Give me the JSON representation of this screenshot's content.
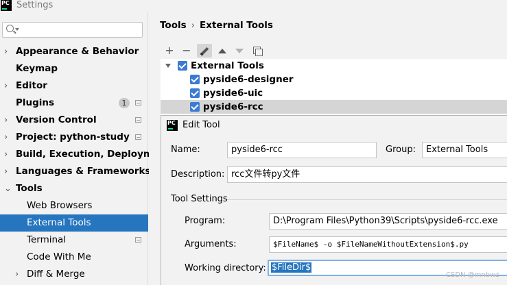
{
  "window": {
    "title": "Settings",
    "logo_text": "PC"
  },
  "search": {
    "placeholder": ""
  },
  "sidebar": {
    "items": [
      {
        "label": "Appearance & Behavior",
        "chevron": "›"
      },
      {
        "label": "Keymap",
        "chevron": ""
      },
      {
        "label": "Editor",
        "chevron": "›"
      },
      {
        "label": "Plugins",
        "chevron": "",
        "badge": "1"
      },
      {
        "label": "Version Control",
        "chevron": "›"
      },
      {
        "label": "Project: python-study",
        "chevron": "›"
      },
      {
        "label": "Build, Execution, Deployment",
        "chevron": "›"
      },
      {
        "label": "Languages & Frameworks",
        "chevron": "›"
      },
      {
        "label": "Tools",
        "chevron": "⌄"
      },
      {
        "label": "Web Browsers",
        "chevron": ""
      },
      {
        "label": "External Tools",
        "chevron": ""
      },
      {
        "label": "Terminal",
        "chevron": ""
      },
      {
        "label": "Code With Me",
        "chevron": ""
      },
      {
        "label": "Diff & Merge",
        "chevron": "›"
      }
    ]
  },
  "breadcrumb": {
    "parent": "Tools",
    "separator": "›",
    "current": "External Tools"
  },
  "toolbar": {
    "add": "+",
    "remove": "−"
  },
  "tree": {
    "group": "External Tools",
    "tools": [
      "pyside6-designer",
      "pyside6-uic",
      "pyside6-rcc"
    ]
  },
  "dialog": {
    "title": "Edit Tool",
    "logo_text": "PC",
    "name_label": "Name:",
    "name_value": "pyside6-rcc",
    "group_label": "Group:",
    "group_value": "External Tools",
    "description_label": "Description:",
    "description_value": "rcc文件转py文件",
    "section_title": "Tool Settings",
    "program_label": "Program:",
    "program_value": "D:\\Program Files\\Python39\\Scripts\\pyside6-rcc.exe",
    "arguments_label": "Arguments:",
    "arguments_value": "$FileName$ -o $FileNameWithoutExtension$.py",
    "workdir_label": "Working directory:",
    "workdir_value": "$FileDir$"
  },
  "watermark": "CSDN @mnbwz",
  "colors": {
    "selection": "#2675bf",
    "checkbox": "#3b7bd4",
    "focus_border": "#7fb1e8"
  }
}
